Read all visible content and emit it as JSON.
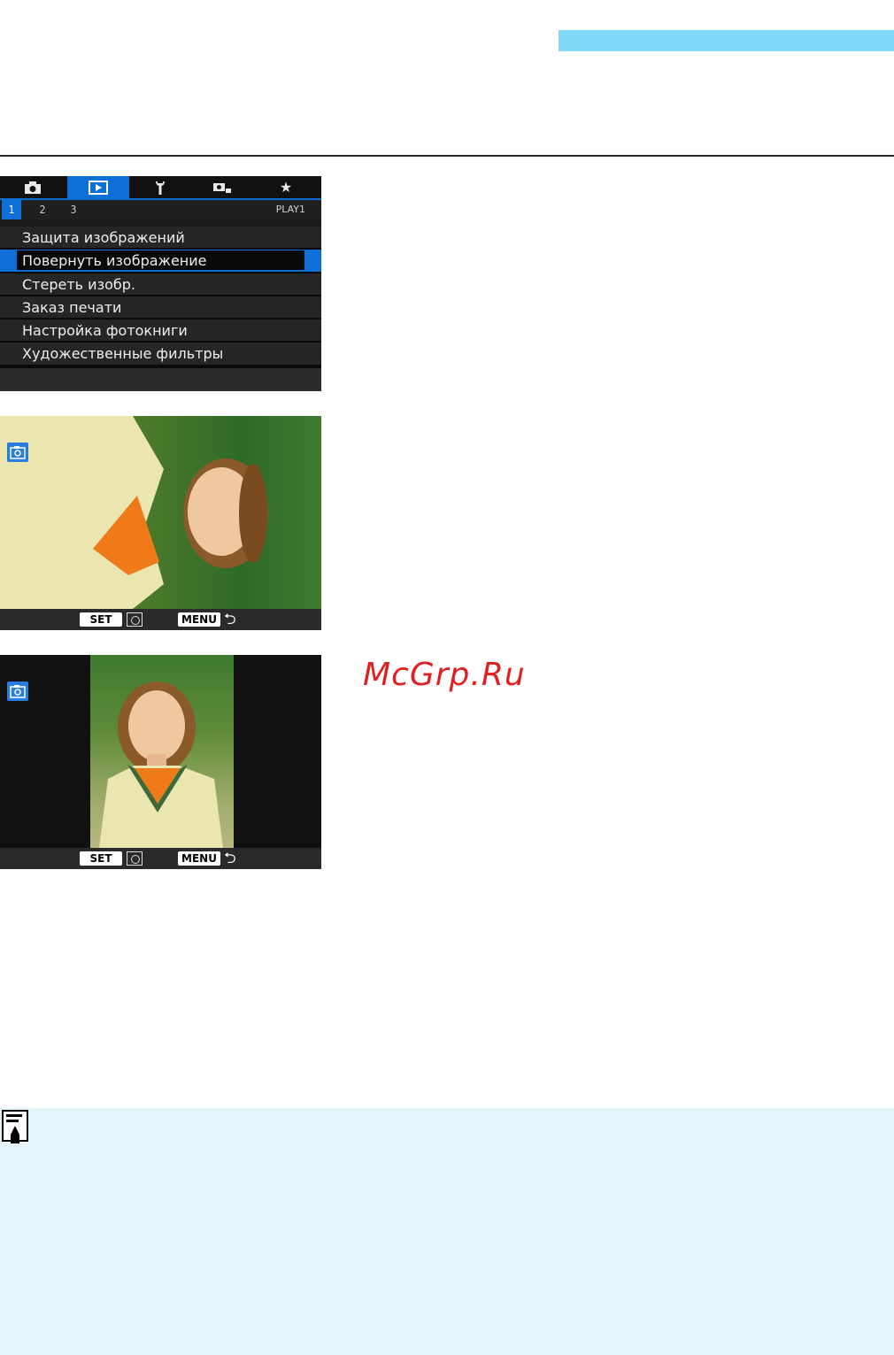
{
  "menu": {
    "tabs": [
      {
        "icon": "camera-icon"
      },
      {
        "icon": "playback-icon",
        "active": true
      },
      {
        "icon": "wrench-icon"
      },
      {
        "icon": "custom-functions-icon"
      },
      {
        "icon": "star-icon"
      }
    ],
    "subtabs": [
      "1",
      "2",
      "3"
    ],
    "page_label": "PLAY1",
    "items": [
      "Защита изображений",
      "Повернуть изображение",
      "Стереть изобр.",
      "Заказ печати",
      "Настройка фотокниги",
      "Художественные фильтры"
    ],
    "selected_index": 1
  },
  "screens": {
    "set_label": "SET",
    "menu_label": "MENU"
  },
  "watermark": "McGrp.Ru",
  "colors": {
    "accent": "#7fd8f8",
    "menu_highlight": "#0e6fd6",
    "note_background": "#e4f5fd",
    "watermark": "#e02020"
  }
}
